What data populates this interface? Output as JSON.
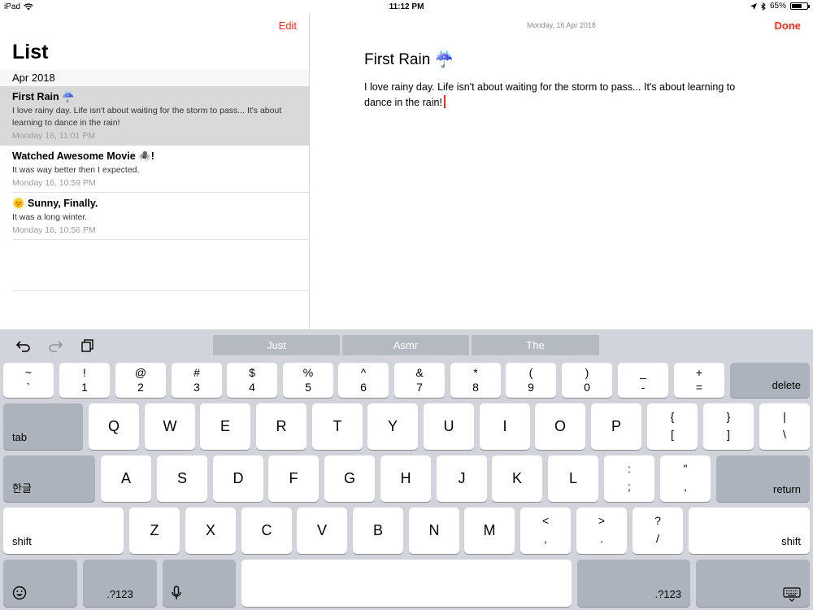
{
  "status": {
    "device": "iPad",
    "time": "11:12 PM",
    "battery": "65%",
    "battery_level": 0.65
  },
  "sidebar": {
    "edit_label": "Edit",
    "title": "List",
    "section": "Apr 2018",
    "notes": [
      {
        "title": "First Rain ☔",
        "body": "I love rainy day. Life isn't about waiting for the storm to pass... It's about learning to dance in the rain!",
        "date": "Monday 16, 11:01 PM"
      },
      {
        "title": "Watched Awesome Movie 🕷️!",
        "body": "It was way better then I expected.",
        "date": "Monday 16, 10:59 PM"
      },
      {
        "title": "🌞 Sunny, Finally.",
        "body": "It was a long winter.",
        "date": "Monday 16, 10:56 PM"
      }
    ]
  },
  "detail": {
    "date": "Monday, 16 Apr 2018",
    "done_label": "Done",
    "title": "First Rain ☔",
    "body": "I love rainy day. Life isn't about waiting for the storm to pass... It's about learning to dance in the rain!"
  },
  "keyboard": {
    "suggestions": [
      "Just",
      "Asmr",
      "The"
    ],
    "row1": [
      {
        "top": "~",
        "bot": "`"
      },
      {
        "top": "!",
        "bot": "1"
      },
      {
        "top": "@",
        "bot": "2"
      },
      {
        "top": "#",
        "bot": "3"
      },
      {
        "top": "$",
        "bot": "4"
      },
      {
        "top": "%",
        "bot": "5"
      },
      {
        "top": "^",
        "bot": "6"
      },
      {
        "top": "&",
        "bot": "7"
      },
      {
        "top": "*",
        "bot": "8"
      },
      {
        "top": "(",
        "bot": "9"
      },
      {
        "top": ")",
        "bot": "0"
      },
      {
        "top": "_",
        "bot": "-"
      },
      {
        "top": "+",
        "bot": "="
      }
    ],
    "delete": "delete",
    "tab": "tab",
    "row2": [
      "Q",
      "W",
      "E",
      "R",
      "T",
      "Y",
      "U",
      "I",
      "O",
      "P"
    ],
    "row2_sym": [
      {
        "top": "{",
        "bot": "["
      },
      {
        "top": "}",
        "bot": "]"
      },
      {
        "top": "|",
        "bot": "\\"
      }
    ],
    "lang": "한글",
    "row3": [
      "A",
      "S",
      "D",
      "F",
      "G",
      "H",
      "J",
      "K",
      "L"
    ],
    "row3_sym": [
      {
        "top": ":",
        "bot": ";"
      },
      {
        "top": "\"",
        "bot": ","
      }
    ],
    "return": "return",
    "shift": "shift",
    "row4": [
      "Z",
      "X",
      "C",
      "V",
      "B",
      "N",
      "M"
    ],
    "row4_sym": [
      {
        "top": "<",
        "bot": ","
      },
      {
        "top": ">",
        "bot": "."
      },
      {
        "top": "?",
        "bot": "/"
      }
    ],
    "num_label": ".?123"
  }
}
